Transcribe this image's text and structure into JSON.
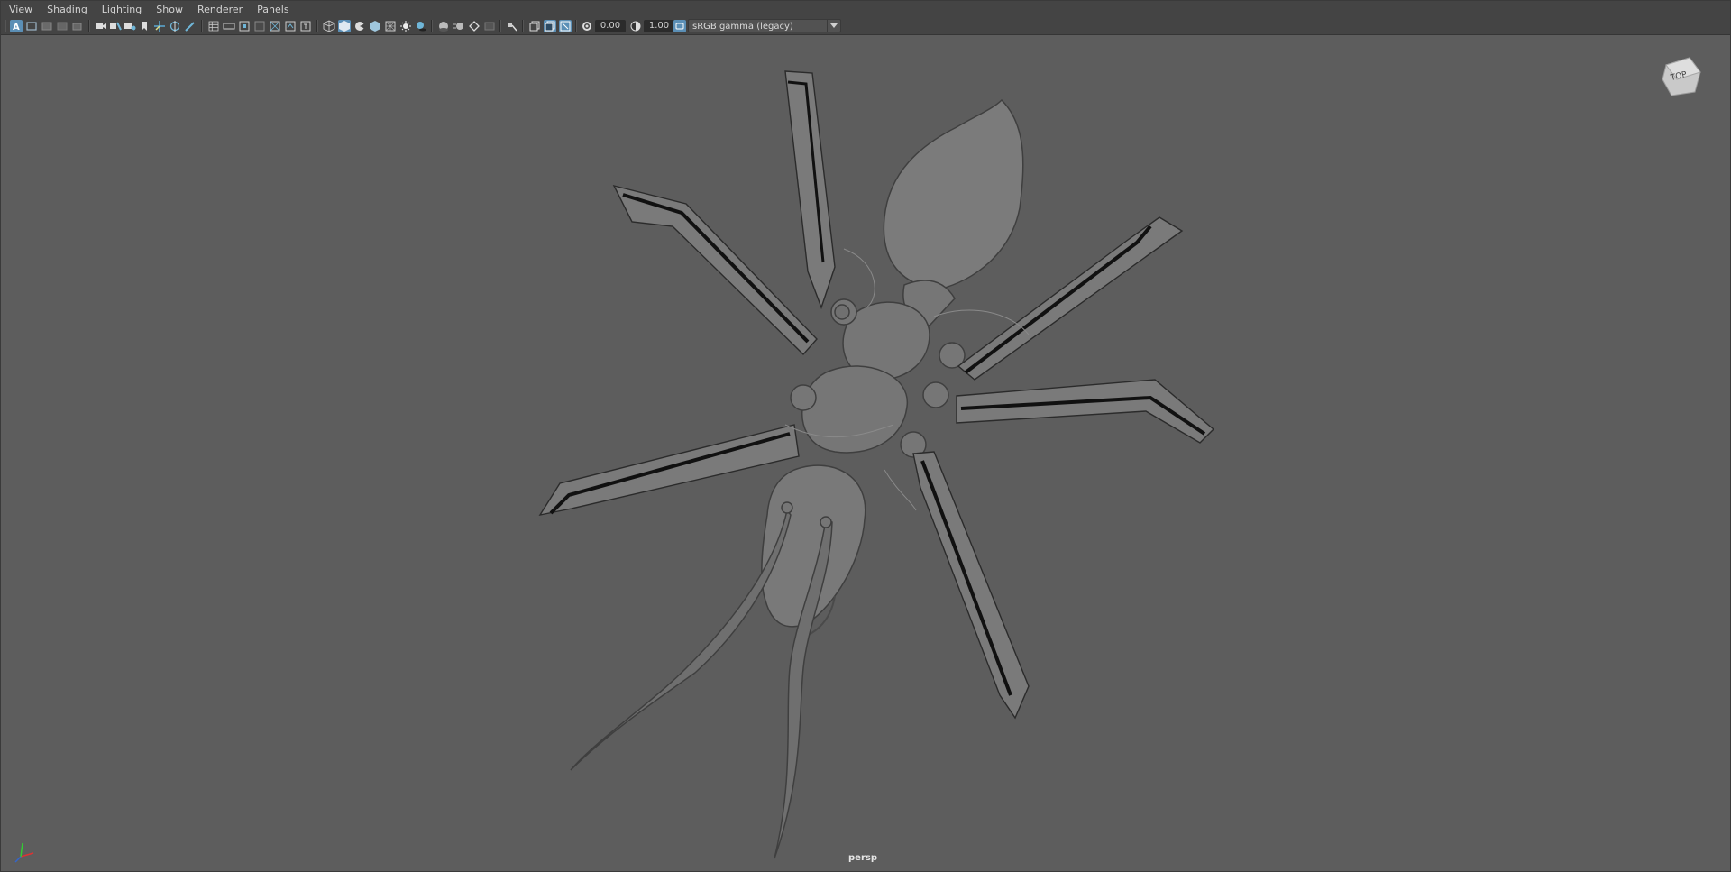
{
  "menubar": {
    "items": [
      "View",
      "Shading",
      "Lighting",
      "Show",
      "Renderer",
      "Panels"
    ]
  },
  "toolbar": {
    "exposure_value": "0.00",
    "gamma_value": "1.00",
    "color_space": "sRGB gamma (legacy)",
    "active_icons": [
      "select-camera-icon",
      "smooth-shade-icon",
      "isolate-select-icon"
    ]
  },
  "viewport": {
    "camera_name": "persp",
    "view_cube_label": "TOP",
    "background_color": "#5d5d5d",
    "model_color": "#7a7a7a"
  }
}
